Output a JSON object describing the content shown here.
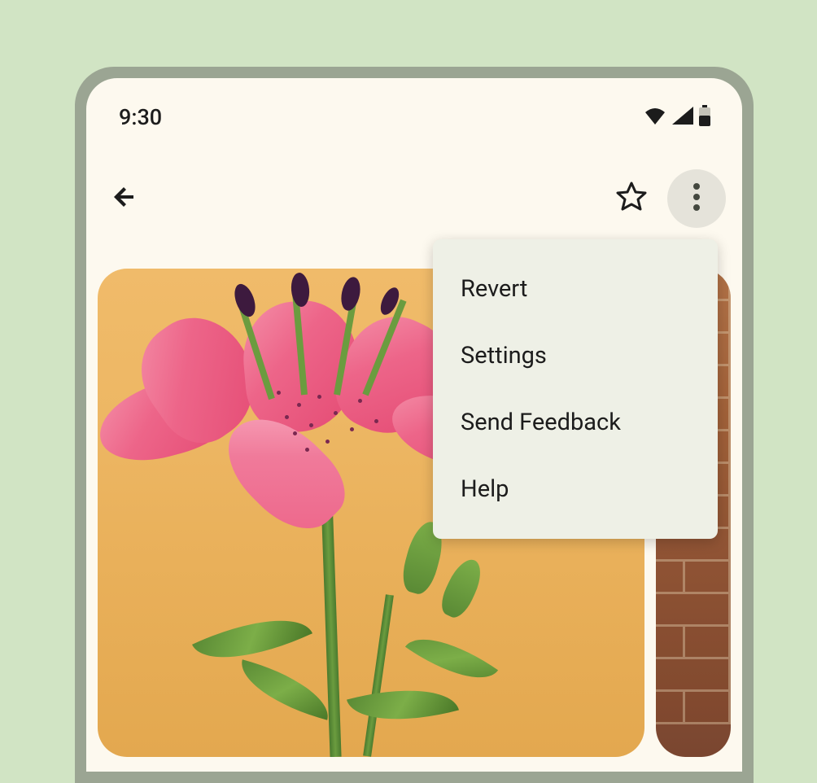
{
  "statusBar": {
    "time": "9:30"
  },
  "menu": {
    "items": [
      {
        "label": "Revert"
      },
      {
        "label": "Settings"
      },
      {
        "label": "Send Feedback"
      },
      {
        "label": "Help"
      }
    ]
  }
}
